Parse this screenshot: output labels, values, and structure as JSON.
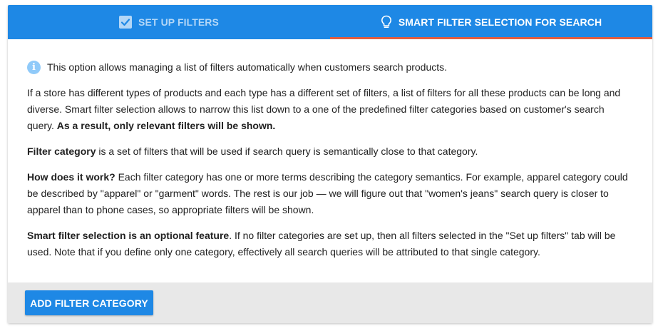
{
  "tabs": [
    {
      "label": "SET UP FILTERS",
      "icon": "checkbox-icon",
      "active": false
    },
    {
      "label": "SMART FILTER SELECTION FOR SEARCH",
      "icon": "lightbulb-icon",
      "active": true
    }
  ],
  "info": {
    "icon": "info-icon",
    "icon_glyph": "i",
    "text": "This option allows managing a list of filters automatically when customers search products."
  },
  "paragraphs": {
    "p1": {
      "text": "If a store has different types of products and each type has a different set of filters, a list of filters for all these products can be long and diverse. Smart filter selection allows to narrow this list down to a one of the predefined filter categories based on customer's search query. ",
      "bold": "As a result, only relevant filters will be shown."
    },
    "p2": {
      "bold": "Filter category",
      "text": " is a set of filters that will be used if search query is semantically close to that category."
    },
    "p3": {
      "bold": "How does it work?",
      "text": " Each filter category has one or more terms describing the category semantics. For example, apparel category could be described by \"apparel\" or \"garment\" words. The rest is our job — we will figure out that \"women's jeans\" search query is closer to apparel than to phone cases, so appropriate filters will be shown."
    },
    "p4": {
      "bold": "Smart filter selection is an optional feature",
      "text": ". If no filter categories are set up, then all filters selected in the \"Set up filters\" tab will be used. Note that if you define only one category, effectively all search queries will be attributed to that single category."
    }
  },
  "footer": {
    "add_button_label": "ADD FILTER CATEGORY"
  },
  "colors": {
    "primary": "#1e88e5",
    "active_tab_indicator": "#e35d3f",
    "info_icon": "#90caf9",
    "footer_bg": "#e8e8e8"
  }
}
